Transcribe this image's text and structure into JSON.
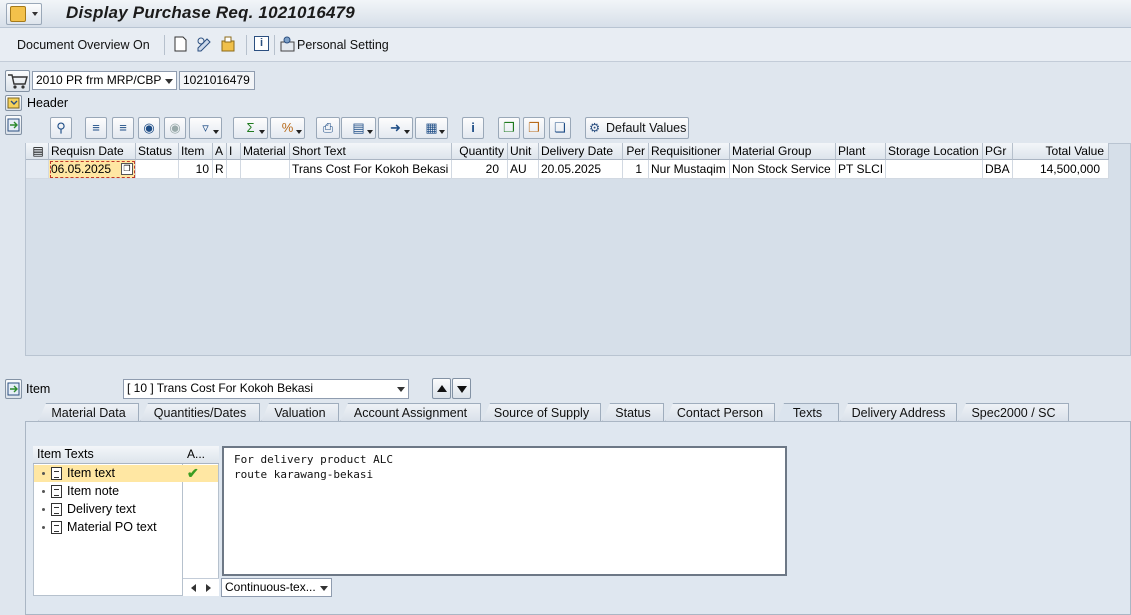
{
  "window": {
    "title": "Display Purchase Req. 1021016479"
  },
  "app_toolbar": {
    "doc_overview_label": "Document Overview On",
    "personal_setting_label": "Personal Setting"
  },
  "header_area": {
    "doc_type_value": "2010 PR frm MRP/CBP",
    "doc_number": "1021016479",
    "header_label": "Header"
  },
  "grid_toolbar": {
    "default_values_label": "Default Values"
  },
  "items_table": {
    "columns": [
      "Requisn Date",
      "Status",
      "Item",
      "A",
      "I",
      "Material",
      "Short Text",
      "Quantity",
      "Unit",
      "Delivery Date",
      "Per",
      "Requisitioner",
      "Material Group",
      "Plant",
      "Storage Location",
      "PGr",
      "Total Value"
    ],
    "rows": [
      [
        "06.05.2025",
        "",
        "10",
        "R",
        "",
        "",
        "Trans Cost For Kokoh Bekasi",
        "20",
        "AU",
        "20.05.2025",
        "1",
        "Nur Mustaqim",
        "Non Stock Service",
        "PT SLCI",
        "",
        "DBA",
        "14,500,000"
      ]
    ]
  },
  "item_section": {
    "label": "Item",
    "selected_item": "[ 10 ] Trans Cost For Kokoh Bekasi"
  },
  "tabs": [
    "Material Data",
    "Quantities/Dates",
    "Valuation",
    "Account Assignment",
    "Source of Supply",
    "Status",
    "Contact Person",
    "Texts",
    "Delivery Address",
    "Spec2000 / SC"
  ],
  "active_tab": "Texts",
  "texts_panel": {
    "tree_header": "Item Texts",
    "a_col_header": "A...",
    "items": [
      "Item text",
      "Item note",
      "Delivery text",
      "Material PO text"
    ],
    "text_lines": [
      "For delivery product ALC",
      "route karawang-bekasi"
    ],
    "format_value": "Continuous-tex..."
  },
  "colors": {
    "selected_row": "#ffe7a3",
    "grid_bg": "#d6dfe9",
    "check": "#3a9c22"
  },
  "icons": [
    "system-menu-icon",
    "new-document-icon",
    "display-change-icon",
    "hold-icon",
    "info-icon",
    "personal-setting-icon",
    "cart-icon",
    "expand-header-icon",
    "expand-grid-icon",
    "collapse-item-icon",
    "up-arrow-icon",
    "down-arrow-icon",
    "checkmark-icon"
  ]
}
